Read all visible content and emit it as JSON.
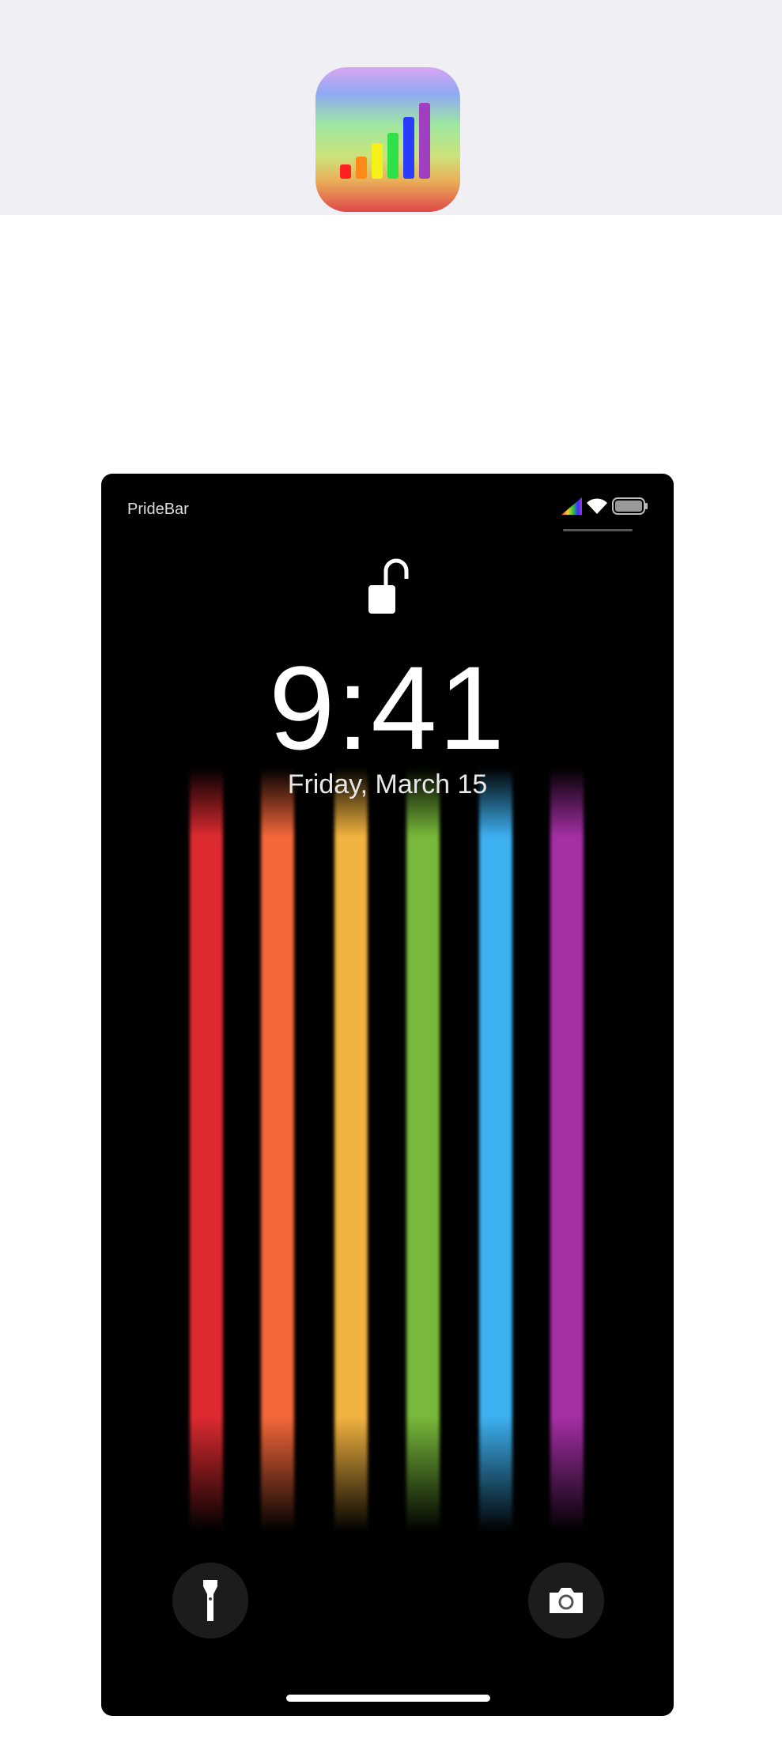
{
  "app_icon": {
    "name": "pridebar-app-icon",
    "bar_colors": [
      "#ff2020",
      "#ff8a1a",
      "#f5f01a",
      "#2ee04a",
      "#2a3cff",
      "#a040c0"
    ]
  },
  "lockscreen": {
    "carrier": "PrideBar",
    "time": "9:41",
    "date": "Friday, March 15",
    "stripe_colors": [
      "#dc2a30",
      "#f4673a",
      "#f1b23f",
      "#78b83a",
      "#3db0ef",
      "#a52fa5"
    ],
    "icons": {
      "lock": "unlocked-padlock-icon",
      "flashlight": "flashlight-icon",
      "camera": "camera-icon",
      "signal": "rainbow-signal-icon",
      "wifi": "wifi-icon",
      "battery": "battery-icon"
    }
  }
}
